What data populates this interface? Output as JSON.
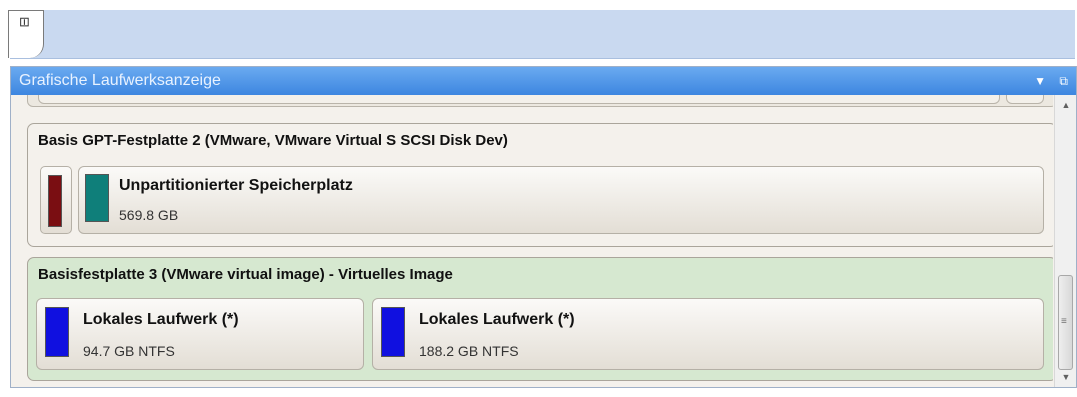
{
  "panel": {
    "title": "Grafische Laufwerksanzeige",
    "controls": [
      "▼",
      "⧉"
    ]
  },
  "tab_icon": "disk-tab-icon",
  "disks": [
    {
      "title": "Basis GPT-Festplatte 2 (VMware, VMware Virtual S SCSI Disk Dev)",
      "background": "#f4f1ec",
      "volumes": [
        {
          "name": "Unpartitionierter Speicherplatz",
          "size": "569.8 GB",
          "color": "#0f7f7a"
        }
      ],
      "reserved_color": "#7a0e12"
    },
    {
      "title": "Basisfestplatte 3 (VMware virtual image) - Virtuelles Image",
      "background": "#d6e8d0",
      "volumes": [
        {
          "name": "Lokales Laufwerk (*)",
          "size": "94.7 GB NTFS",
          "color": "#1010e0"
        },
        {
          "name": "Lokales Laufwerk (*)",
          "size": "188.2 GB NTFS",
          "color": "#1010e0"
        }
      ]
    }
  ],
  "scrollbar": {
    "up": "▲",
    "down": "▼",
    "grip": "≡"
  }
}
